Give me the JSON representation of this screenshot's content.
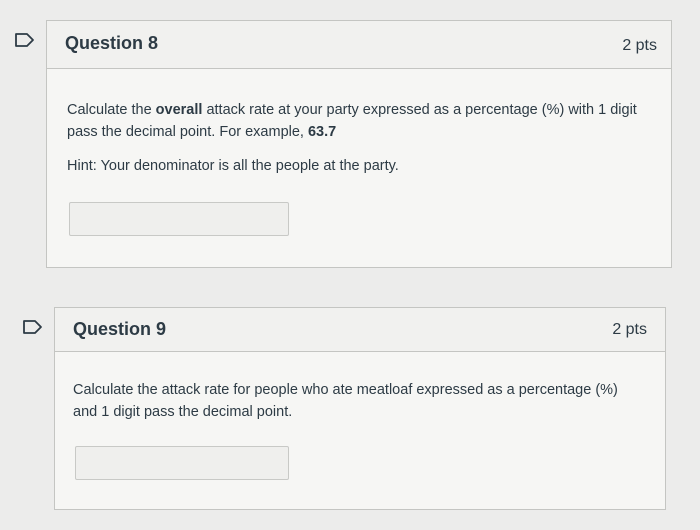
{
  "questions": [
    {
      "title": "Question 8",
      "points": "2 pts",
      "text_before": "Calculate the ",
      "text_bold": "overall",
      "text_after": " attack rate at your party expressed as a percentage (%) with 1 digit pass the decimal point. For example, ",
      "example_value": "63.7",
      "hint": "Hint: Your denominator is all the people at the party.",
      "answer_value": ""
    },
    {
      "title": "Question 9",
      "points": "2 pts",
      "text": "Calculate the attack rate for people who ate meatloaf expressed as a percentage (%) and 1 digit pass the decimal point.",
      "answer_value": ""
    }
  ],
  "icons": {
    "flag_icon": "flag-question-icon"
  },
  "colors": {
    "page_background": "#ececeb",
    "card_background": "#f6f6f4",
    "border": "#c4c5c2",
    "text": "#2d3b45"
  }
}
